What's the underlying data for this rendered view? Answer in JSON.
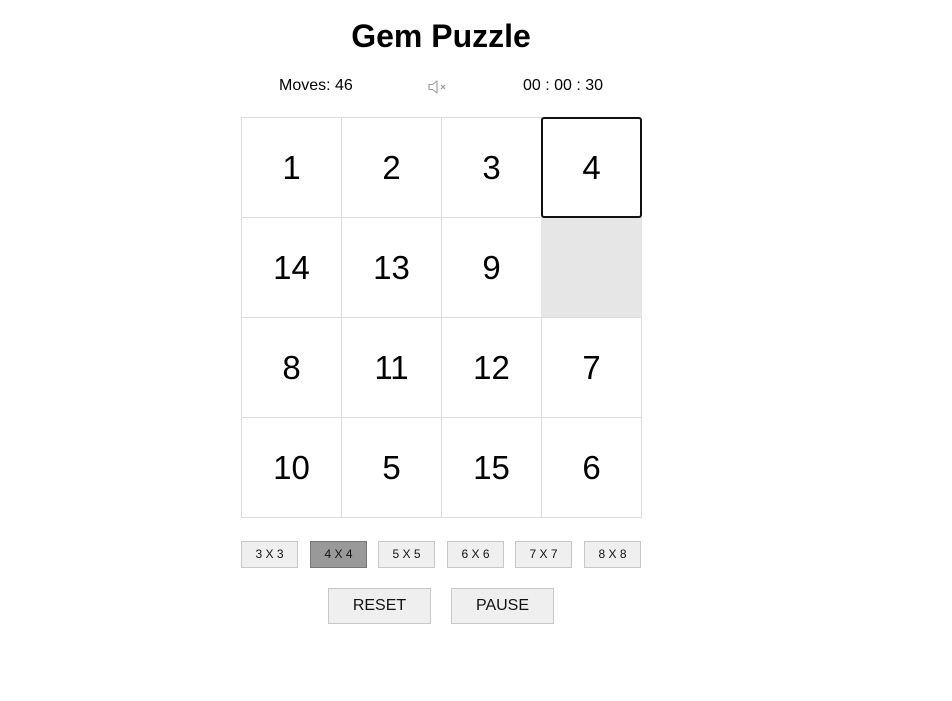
{
  "title": "Gem Puzzle",
  "status": {
    "moves_label": "Moves: 46",
    "timer": "00 : 00 : 30",
    "sound_icon": "speaker-muted-icon"
  },
  "board": {
    "size": "4 X 4",
    "tiles": [
      "1",
      "2",
      "3",
      "4",
      "14",
      "13",
      "9",
      "",
      "8",
      "11",
      "12",
      "7",
      "10",
      "5",
      "15",
      "6"
    ],
    "selected_tile": "4",
    "empty_color": "#e6e6e6"
  },
  "size_options": [
    "3 X 3",
    "4 X 4",
    "5 X 5",
    "6 X 6",
    "7 X 7",
    "8 X 8"
  ],
  "active_size": "4 X 4",
  "actions": {
    "reset_label": "RESET",
    "pause_label": "PAUSE"
  }
}
